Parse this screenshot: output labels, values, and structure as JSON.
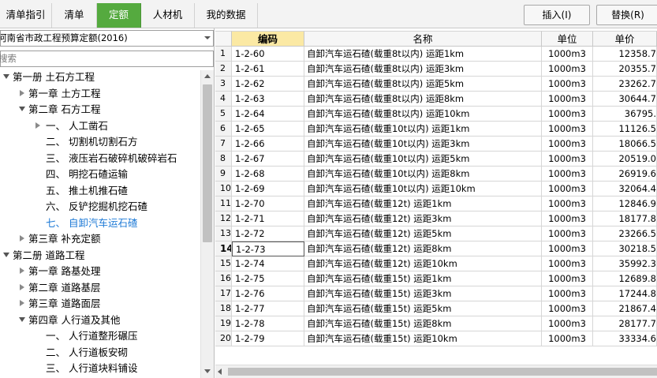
{
  "tabs": [
    {
      "label": "清单指引"
    },
    {
      "label": "清单"
    },
    {
      "label": "定额"
    },
    {
      "label": "人材机"
    },
    {
      "label": "我的数据"
    }
  ],
  "buttons": {
    "insert": "插入(I)",
    "replace": "替换(R)"
  },
  "library": {
    "selected": "河南省市政工程预算定额(2016)"
  },
  "search": {
    "placeholder": "搜索"
  },
  "tree": [
    {
      "label": "第一册 土石方工程",
      "level": 0,
      "state": "expanded"
    },
    {
      "label": "第一章 土方工程",
      "level": 1,
      "state": "collapsed"
    },
    {
      "label": "第二章 石方工程",
      "level": 1,
      "state": "expanded"
    },
    {
      "label": "一、 人工凿石",
      "level": 2,
      "state": "collapsed"
    },
    {
      "label": "二、 切割机切割石方",
      "level": 2,
      "state": "leaf"
    },
    {
      "label": "三、 液压岩石破碎机破碎岩石",
      "level": 2,
      "state": "leaf"
    },
    {
      "label": "四、 明挖石碴运输",
      "level": 2,
      "state": "leaf"
    },
    {
      "label": "五、 推土机推石碴",
      "level": 2,
      "state": "leaf"
    },
    {
      "label": "六、 反铲挖掘机挖石碴",
      "level": 2,
      "state": "leaf"
    },
    {
      "label": "七、 自卸汽车运石碴",
      "level": 2,
      "state": "leaf",
      "selected": true
    },
    {
      "label": "第三章 补充定额",
      "level": 1,
      "state": "collapsed"
    },
    {
      "label": "第二册 道路工程",
      "level": 0,
      "state": "expanded"
    },
    {
      "label": "第一章 路基处理",
      "level": 1,
      "state": "collapsed"
    },
    {
      "label": "第二章 道路基层",
      "level": 1,
      "state": "collapsed"
    },
    {
      "label": "第三章 道路面层",
      "level": 1,
      "state": "collapsed"
    },
    {
      "label": "第四章 人行道及其他",
      "level": 1,
      "state": "expanded"
    },
    {
      "label": "一、 人行道整形碾压",
      "level": 2,
      "state": "leaf"
    },
    {
      "label": "二、 人行道板安砌",
      "level": 2,
      "state": "leaf"
    },
    {
      "label": "三、 人行道块料铺设",
      "level": 2,
      "state": "leaf"
    }
  ],
  "grid": {
    "columns": {
      "code": "编码",
      "name": "名称",
      "unit": "单位",
      "price": "单价"
    },
    "current_row": 14,
    "rows": [
      {
        "idx": "1",
        "code": "1-2-60",
        "name": "自卸汽车运石碴(载重8t以内) 运距1km",
        "unit": "1000m3",
        "price": "12358.7"
      },
      {
        "idx": "2",
        "code": "1-2-61",
        "name": "自卸汽车运石碴(载重8t以内) 运距3km",
        "unit": "1000m3",
        "price": "20355.7"
      },
      {
        "idx": "3",
        "code": "1-2-62",
        "name": "自卸汽车运石碴(载重8t以内) 运距5km",
        "unit": "1000m3",
        "price": "23262.7"
      },
      {
        "idx": "4",
        "code": "1-2-63",
        "name": "自卸汽车运石碴(载重8t以内) 运距8km",
        "unit": "1000m3",
        "price": "30644.7"
      },
      {
        "idx": "5",
        "code": "1-2-64",
        "name": "自卸汽车运石碴(载重8t以内) 运距10km",
        "unit": "1000m3",
        "price": "36795."
      },
      {
        "idx": "6",
        "code": "1-2-65",
        "name": "自卸汽车运石碴(载重10t以内) 运距1km",
        "unit": "1000m3",
        "price": "11126.5"
      },
      {
        "idx": "7",
        "code": "1-2-66",
        "name": "自卸汽车运石碴(载重10t以内) 运距3km",
        "unit": "1000m3",
        "price": "18066.5"
      },
      {
        "idx": "8",
        "code": "1-2-67",
        "name": "自卸汽车运石碴(载重10t以内) 运距5km",
        "unit": "1000m3",
        "price": "20519.0"
      },
      {
        "idx": "9",
        "code": "1-2-68",
        "name": "自卸汽车运石碴(载重10t以内) 运距8km",
        "unit": "1000m3",
        "price": "26919.6"
      },
      {
        "idx": "10",
        "code": "1-2-69",
        "name": "自卸汽车运石碴(载重10t以内) 运距10km",
        "unit": "1000m3",
        "price": "32064.4"
      },
      {
        "idx": "11",
        "code": "1-2-70",
        "name": "自卸汽车运石碴(载重12t) 运距1km",
        "unit": "1000m3",
        "price": "12846.9"
      },
      {
        "idx": "12",
        "code": "1-2-71",
        "name": "自卸汽车运石碴(载重12t) 运距3km",
        "unit": "1000m3",
        "price": "18177.8"
      },
      {
        "idx": "13",
        "code": "1-2-72",
        "name": "自卸汽车运石碴(载重12t) 运距5km",
        "unit": "1000m3",
        "price": "23266.5"
      },
      {
        "idx": "14",
        "code": "1-2-73",
        "name": "自卸汽车运石碴(载重12t) 运距8km",
        "unit": "1000m3",
        "price": "30218.5"
      },
      {
        "idx": "15",
        "code": "1-2-74",
        "name": "自卸汽车运石碴(载重12t) 运距10km",
        "unit": "1000m3",
        "price": "35992.3"
      },
      {
        "idx": "16",
        "code": "1-2-75",
        "name": "自卸汽车运石碴(载重15t) 运距1km",
        "unit": "1000m3",
        "price": "12689.8"
      },
      {
        "idx": "17",
        "code": "1-2-76",
        "name": "自卸汽车运石碴(载重15t) 运距3km",
        "unit": "1000m3",
        "price": "17244.8"
      },
      {
        "idx": "18",
        "code": "1-2-77",
        "name": "自卸汽车运石碴(载重15t) 运距5km",
        "unit": "1000m3",
        "price": "21867.4"
      },
      {
        "idx": "19",
        "code": "1-2-78",
        "name": "自卸汽车运石碴(载重15t) 运距8km",
        "unit": "1000m3",
        "price": "28177.7"
      },
      {
        "idx": "20",
        "code": "1-2-79",
        "name": "自卸汽车运石碴(载重15t) 运距10km",
        "unit": "1000m3",
        "price": "33334.6"
      }
    ]
  },
  "colors": {
    "active_tab": "#55aa3f",
    "selected_tree_text": "#1e7ad6",
    "column_highlight": "#fbe9a4"
  }
}
